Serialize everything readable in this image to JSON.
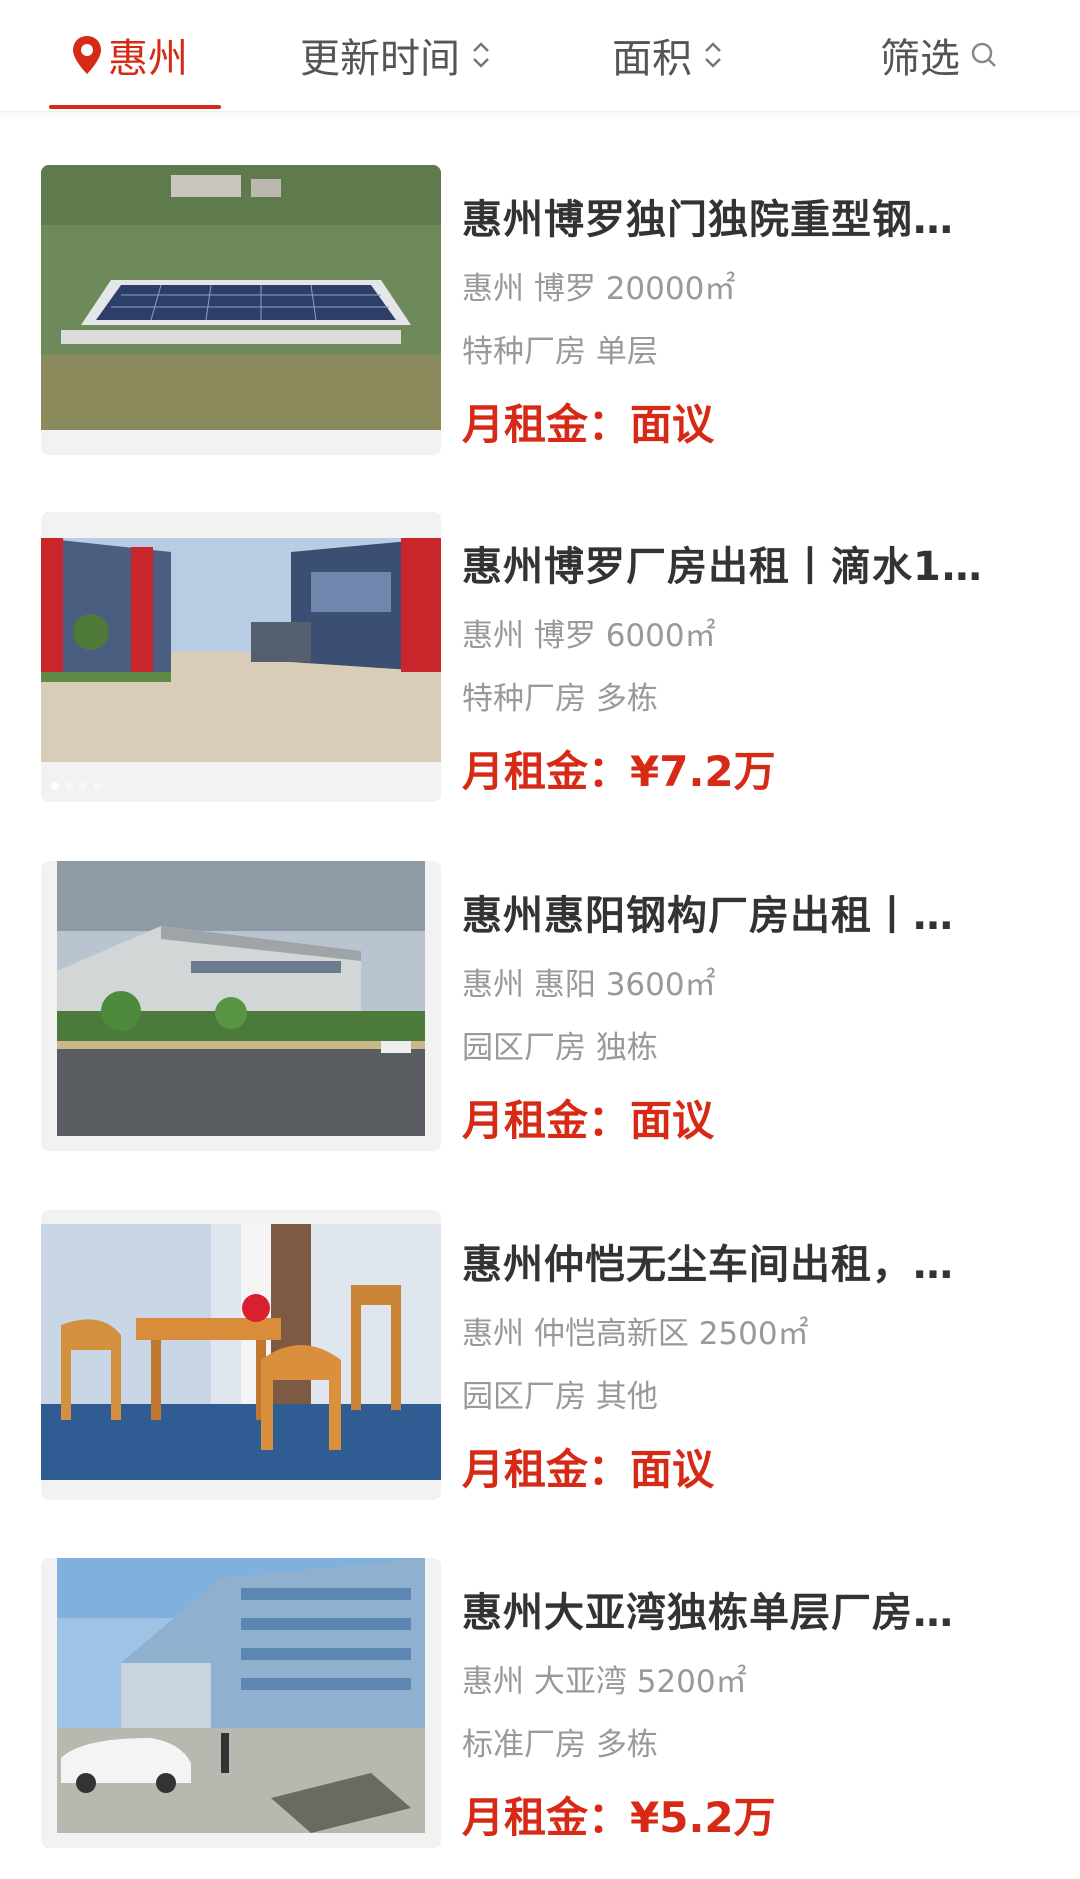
{
  "filter_bar": {
    "city": "惠州",
    "sort_time": "更新时间",
    "sort_area": "面积",
    "filter": "筛选"
  },
  "listings": [
    {
      "title": "惠州博罗独门独院重型钢…",
      "location": "惠州 博罗 20000㎡",
      "type": "特种厂房 单层",
      "rent_label": "月租金：",
      "rent_value": "面议"
    },
    {
      "title": "惠州博罗厂房出租丨滴水1…",
      "location": "惠州 博罗 6000㎡",
      "type": "特种厂房 多栋",
      "rent_label": "月租金：",
      "rent_value": "¥7.2万"
    },
    {
      "title": "惠州惠阳钢构厂房出租丨…",
      "location": "惠州 惠阳 3600㎡",
      "type": "园区厂房 独栋",
      "rent_label": "月租金：",
      "rent_value": "面议"
    },
    {
      "title": "惠州仲恺无尘车间出租，…",
      "location": "惠州 仲恺高新区 2500㎡",
      "type": "园区厂房 其他",
      "rent_label": "月租金：",
      "rent_value": "面议"
    },
    {
      "title": "惠州大亚湾独栋单层厂房…",
      "location": "惠州 大亚湾 5200㎡",
      "type": "标准厂房 多栋",
      "rent_label": "月租金：",
      "rent_value": "¥5.2万"
    }
  ],
  "colors": {
    "accent": "#d62a16",
    "text": "#333333",
    "muted": "#999999"
  }
}
